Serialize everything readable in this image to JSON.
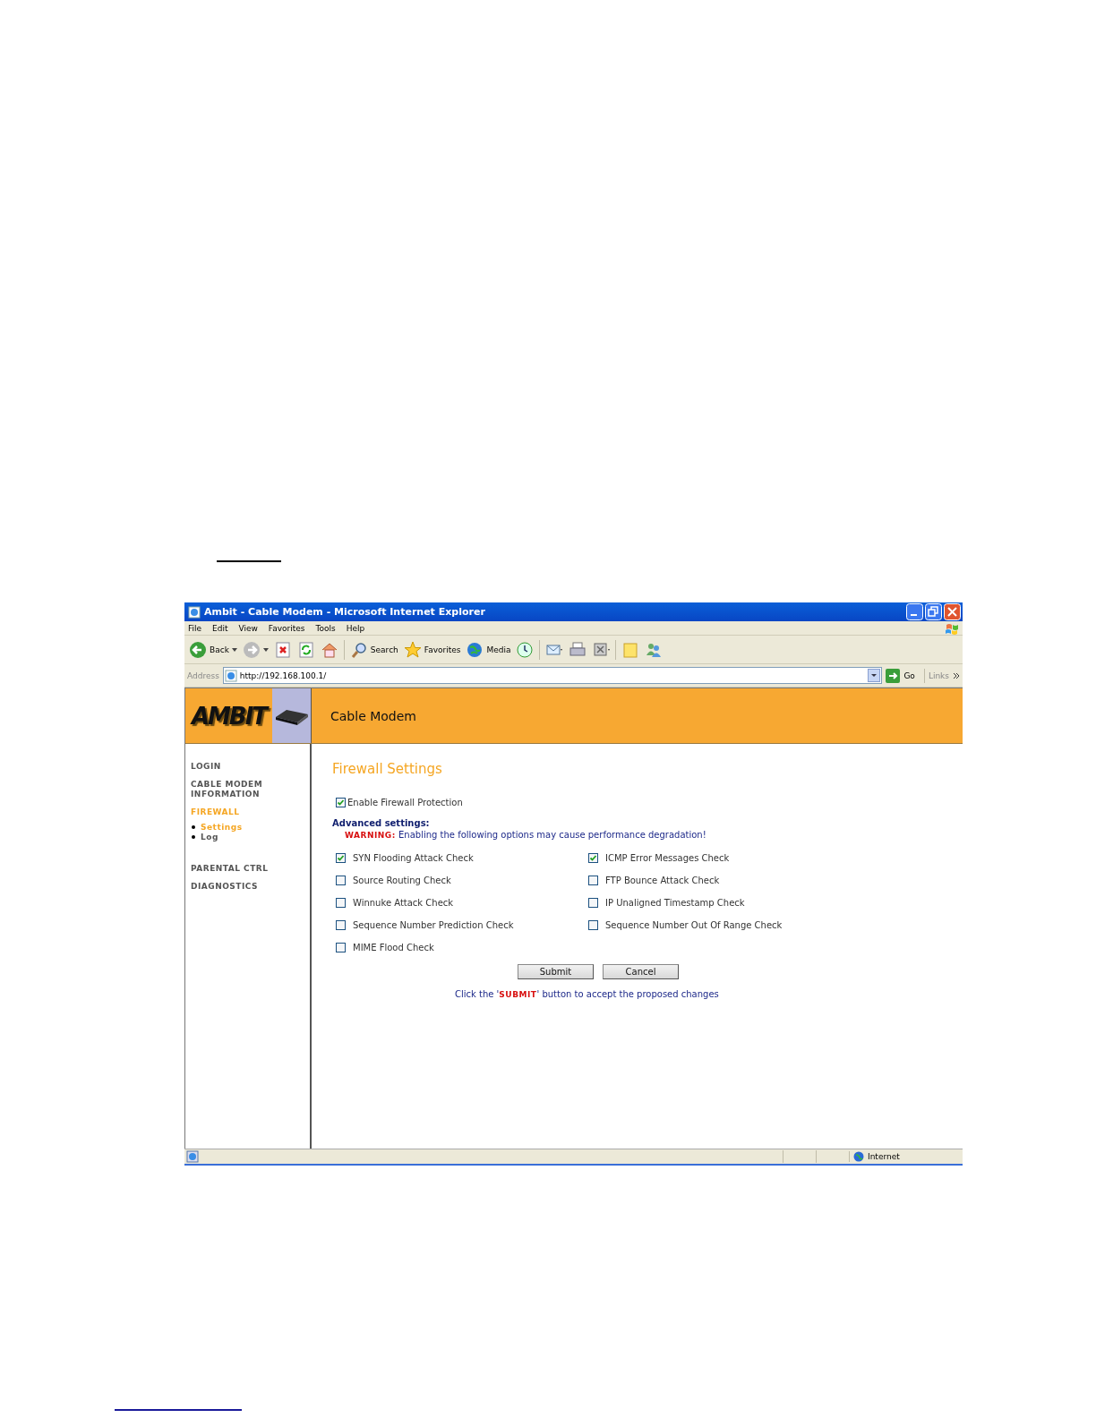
{
  "window": {
    "title": "Ambit - Cable Modem - Microsoft Internet Explorer"
  },
  "menu": [
    {
      "label": "File"
    },
    {
      "label": "Edit"
    },
    {
      "label": "View"
    },
    {
      "label": "Favorites"
    },
    {
      "label": "Tools"
    },
    {
      "label": "Help"
    }
  ],
  "toolbar": [
    {
      "kind": "back",
      "label": "Back"
    },
    {
      "kind": "forward"
    },
    {
      "kind": "stop"
    },
    {
      "kind": "refresh"
    },
    {
      "kind": "home"
    },
    {
      "kind": "search",
      "label": "Search"
    },
    {
      "kind": "favorites",
      "label": "Favorites"
    },
    {
      "kind": "media",
      "label": "Media"
    },
    {
      "kind": "history"
    },
    {
      "kind": "mail"
    },
    {
      "kind": "print"
    },
    {
      "kind": "edit"
    },
    {
      "kind": "note"
    },
    {
      "kind": "messenger"
    }
  ],
  "address_bar": {
    "label": "Address",
    "url": "http://192.168.100.1/",
    "go": "Go",
    "links": "Links"
  },
  "site": {
    "logo": "AMBIT",
    "title": "Cable Modem"
  },
  "sidebar": {
    "items": [
      {
        "label": "LOGIN",
        "selected": false
      },
      {
        "label": "CABLE MODEM INFORMATION",
        "selected": false
      },
      {
        "label": "FIREWALL",
        "selected": true,
        "children": [
          {
            "label": "Settings",
            "selected": true
          },
          {
            "label": "Log",
            "selected": false
          }
        ]
      },
      {
        "label": "PARENTAL CTRL",
        "selected": false
      },
      {
        "label": "DIAGNOSTICS",
        "selected": false
      }
    ]
  },
  "content": {
    "heading": "Firewall Settings",
    "enable": {
      "label": "Enable Firewall Protection",
      "checked": true
    },
    "advanced_label": "Advanced settings:",
    "warning": "**WARNING:** Enabling the following options may cause performance degradation!",
    "options": [
      {
        "label": "SYN Flooding Attack Check",
        "checked": true
      },
      {
        "label": "ICMP Error Messages Check",
        "checked": true
      },
      {
        "label": "Source Routing Check",
        "checked": false
      },
      {
        "label": "FTP Bounce Attack Check",
        "checked": false
      },
      {
        "label": "Winnuke Attack Check",
        "checked": false
      },
      {
        "label": "IP Unaligned Timestamp Check",
        "checked": false
      },
      {
        "label": "Sequence Number Prediction Check",
        "checked": false
      },
      {
        "label": "Sequence Number Out Of Range Check",
        "checked": false
      },
      {
        "label": "MIME Flood Check",
        "checked": false
      }
    ],
    "buttons": [
      "Submit",
      "Cancel"
    ],
    "hint": "Click the '**SUBMIT**' button to accept the proposed changes"
  },
  "status_bar": {
    "zone": "Internet"
  }
}
